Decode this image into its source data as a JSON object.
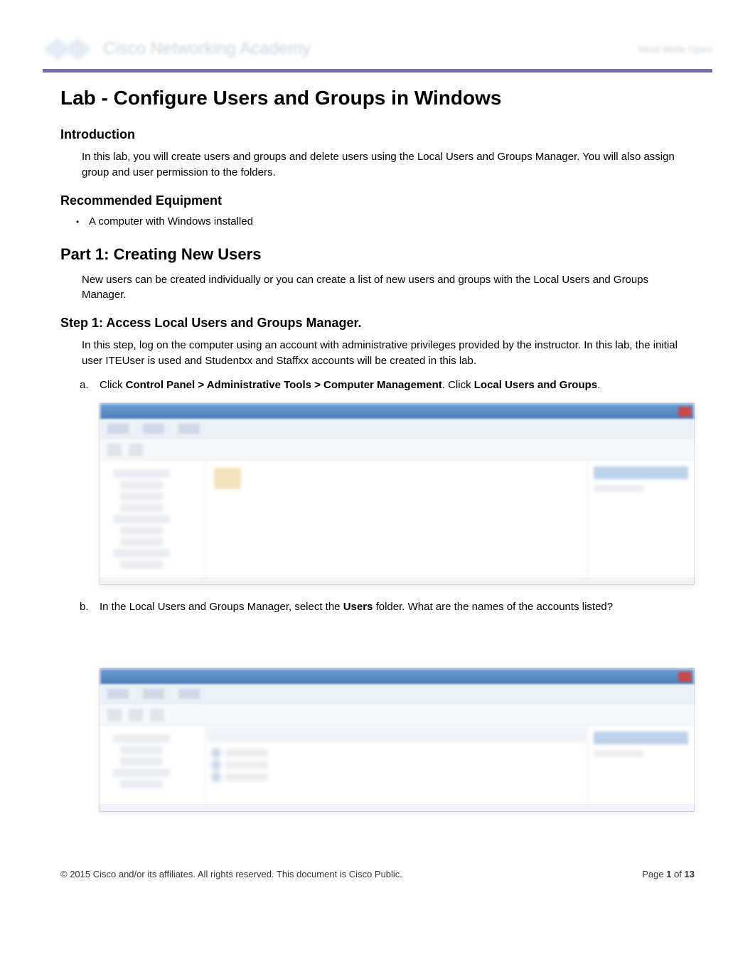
{
  "header": {
    "brand": "cisco",
    "academy": "Cisco Networking Academy",
    "tagline": "Mind Wide Open"
  },
  "title": "Lab - Configure Users and Groups in Windows",
  "intro": {
    "heading": "Introduction",
    "text": "In this lab, you will create users and groups and delete users using the Local Users and Groups Manager. You will also assign group and user permission to the folders."
  },
  "equipment": {
    "heading": "Recommended Equipment",
    "item": "A computer with Windows installed"
  },
  "part1": {
    "heading": "Part 1: Creating New Users",
    "intro": "New users can be created individually or you can create a list of new users and groups with the Local Users and Groups Manager."
  },
  "step1": {
    "heading": "Step 1: Access Local Users and Groups Manager.",
    "intro": "In this step, log on the computer using an account with administrative privileges provided by the instructor. In this lab, the initial user ITEUser is used and Studentxx and Staffxx accounts will be created in this lab.",
    "a": {
      "marker": "a.",
      "pre": "Click ",
      "bold1": "Control Panel > Administrative Tools > Computer Management",
      "mid": ". Click ",
      "bold2": "Local Users and Groups",
      "post": "."
    },
    "b": {
      "marker": "b.",
      "pre": "In the Local Users and Groups Manager, select the ",
      "bold1": "Users",
      "post": " folder. What are the names of the accounts listed?"
    }
  },
  "footer": {
    "copyright": "© 2015 Cisco and/or its affiliates. All rights reserved. This document is Cisco Public.",
    "page_label": "Page ",
    "page_current": "1",
    "page_of": " of ",
    "page_total": "13"
  }
}
